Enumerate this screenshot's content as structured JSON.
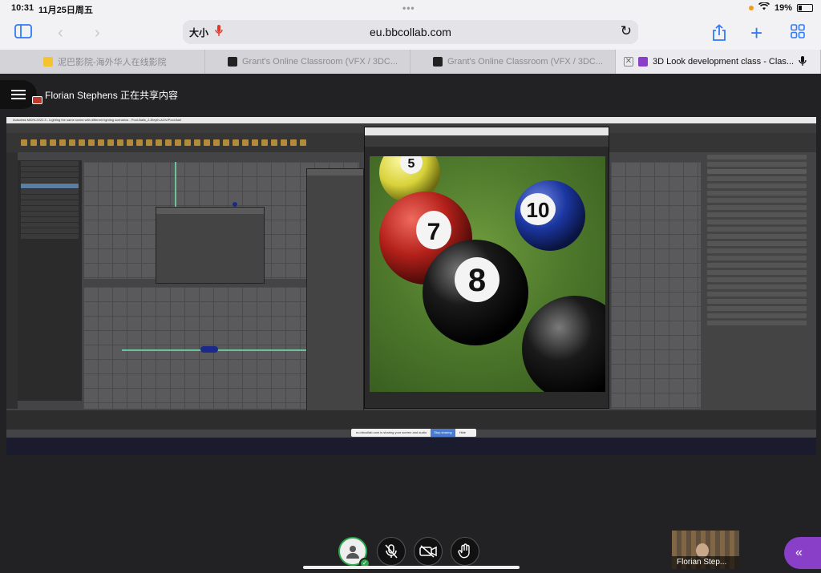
{
  "status_bar": {
    "time": "10:31",
    "date": "11月25日周五",
    "battery": "19%"
  },
  "browser": {
    "text_size": "大小",
    "url": "eu.bbcollab.com",
    "tabs": [
      {
        "label": "泥巴影院-海外华人在线影院",
        "icon_color": "#f4c430"
      },
      {
        "label": "Grant's Online Classroom (VFX / 3DC...",
        "icon_color": "#222222"
      },
      {
        "label": "Grant's Online Classroom (VFX / 3DC...",
        "icon_color": "#222222"
      },
      {
        "label": "3D Look development class - Clas...",
        "icon_color": "#8a3fc8"
      }
    ]
  },
  "collaborate": {
    "sharer_text": "Florian Stephens 正在共享内容",
    "participant_name": "Florian Step...",
    "accent_color": "#8a3fc8"
  },
  "shared_screen": {
    "maya_title": "Autodesk MAYA 2022.3 - Lighting the same scene with different lighting scenarios - Pool-Balls_2-Eleyth-AOV/Pool-Ball",
    "sharing_notice": "eu.bbcollab.com is sharing your screen and audio",
    "stop_sharing": "Stop sharing",
    "hide": "Hide",
    "balls": [
      {
        "number": "5",
        "color": "#e6e04a"
      },
      {
        "number": "7",
        "color": "#c4231c"
      },
      {
        "number": "10",
        "color": "#1c3fb0"
      },
      {
        "number": "8",
        "color": "#111111"
      }
    ]
  }
}
